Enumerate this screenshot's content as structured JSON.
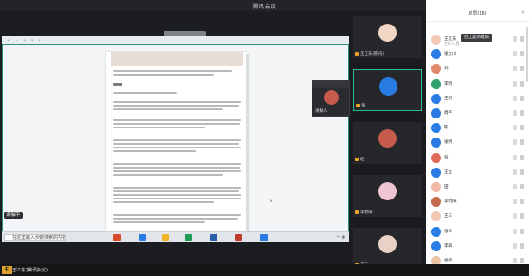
{
  "window": {
    "title": "腾讯会议",
    "controls": [
      "—",
      "□",
      "✕"
    ]
  },
  "share": {
    "doc_heading": "1.",
    "presenter_tag": "讲解中",
    "taskbar": {
      "search_placeholder": "在这里输入你要搜索的内容",
      "apps": [
        {
          "label": "",
          "color": "#d94a2b"
        },
        {
          "label": "",
          "color": "#2a7be4"
        },
        {
          "label": "",
          "color": "#f0b429"
        },
        {
          "label": "",
          "color": "#1f9d55"
        },
        {
          "label": "",
          "color": "#2b5fad"
        },
        {
          "label": "",
          "color": "#c0392b"
        },
        {
          "label": "",
          "color": "#2a7be4"
        }
      ],
      "tray": "^ 中"
    }
  },
  "pip": {
    "label": "讲解人"
  },
  "bottombar": {
    "host_badge": "主",
    "host_name": "王江东(腾讯会议)"
  },
  "gallery": [
    {
      "name": "王江东(腾讯)",
      "color": "#f2d7c4",
      "active": false
    },
    {
      "name": "张",
      "color": "#2a7be4",
      "active": true
    },
    {
      "name": "赵",
      "color": "#c65a4b",
      "active": false
    },
    {
      "name": "李明阳",
      "color": "#f1c6d3",
      "active": false
    },
    {
      "name": "王三",
      "color": "#e8d2c8",
      "active": false
    }
  ],
  "panel": {
    "title": "成员(16)",
    "close": "✕",
    "tooltip": "已上麦的成员",
    "members": [
      {
        "name": "王江东",
        "sub": "主持人,我",
        "color": "#f3c9b8"
      },
      {
        "name": "张大川",
        "sub": "",
        "color": "#2a7be4"
      },
      {
        "name": "刘",
        "sub": "",
        "color": "#e08a6e"
      },
      {
        "name": "李明",
        "sub": "",
        "color": "#2fa36b"
      },
      {
        "name": "王明",
        "sub": "",
        "color": "#2a7be4"
      },
      {
        "name": "周平",
        "sub": "",
        "color": "#2a7be4"
      },
      {
        "name": "陈",
        "sub": "",
        "color": "#2a7be4"
      },
      {
        "name": "张明",
        "sub": "",
        "color": "#2a7be4"
      },
      {
        "name": "赵",
        "sub": "",
        "color": "#e06a5a"
      },
      {
        "name": "王立",
        "sub": "",
        "color": "#2a7be4"
      },
      {
        "name": "田",
        "sub": "",
        "color": "#f2b8a8"
      },
      {
        "name": "李明阳",
        "sub": "",
        "color": "#c86a4e"
      },
      {
        "name": "王三",
        "sub": "",
        "color": "#f0c7b1"
      },
      {
        "name": "张三",
        "sub": "",
        "color": "#2a7be4"
      },
      {
        "name": "李四",
        "sub": "",
        "color": "#2a7be4"
      },
      {
        "name": "张四",
        "sub": "",
        "color": "#e9c3a2"
      }
    ]
  }
}
